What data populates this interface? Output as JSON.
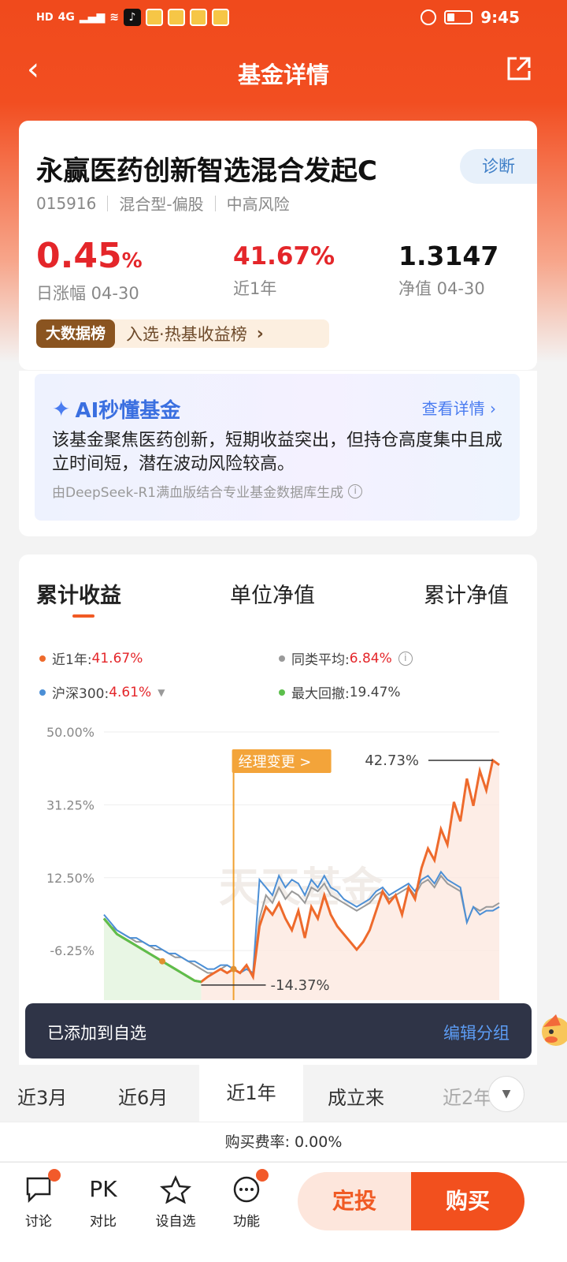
{
  "status_bar": {
    "hd": "HD",
    "network": "4G",
    "time": "9:45"
  },
  "nav": {
    "title": "基金详情"
  },
  "fund": {
    "name": "永赢医药创新智选混合发起C",
    "code": "015916",
    "type": "混合型-偏股",
    "risk": "中高风险",
    "diagnose_label": "诊断",
    "daily_change": "0.45",
    "daily_change_unit": "%",
    "daily_change_label": "日涨幅 04-30",
    "year_return": "41.67%",
    "year_return_label": "近1年",
    "nav_value": "1.3147",
    "nav_label": "净值 04-30",
    "rank_tag": "大数据榜",
    "rank_text": "入选·热基收益榜"
  },
  "ai": {
    "title": "AI秒懂基金",
    "more": "查看详情",
    "body": "该基金聚焦医药创新，短期收益突出，但持仓高度集中且成立时间短，潜在波动风险较高。",
    "footer": "由DeepSeek-R1满血版结合专业基金数据库生成"
  },
  "chart_tabs": [
    "累计收益",
    "单位净值",
    "累计净值"
  ],
  "legend": {
    "fund_label": "近1年:",
    "fund_value": "41.67%",
    "peer_label": "同类平均:",
    "peer_value": "6.84%",
    "index_label": "沪深300:",
    "index_value": "4.61%",
    "drawdown_label": "最大回撤:",
    "drawdown_value": "19.47%"
  },
  "colors": {
    "fund": "#ee6a2c",
    "peer": "#9a9a9a",
    "index": "#4b8fd6",
    "drawdown": "#5cbf4c",
    "accent": "#f2501e"
  },
  "chart_data": {
    "type": "line",
    "ylabel_ticks": [
      "50.00%",
      "31.25%",
      "12.50%",
      "-6.25%"
    ],
    "ylim": [
      -19,
      50
    ],
    "annotations": {
      "manager_change": "经理变更 >",
      "max_label": "42.73%",
      "min_label": "-14.37%",
      "watermark": "天天基金"
    },
    "x_count": 62,
    "series": [
      {
        "key": "fund",
        "values": [
          2,
          0,
          -2,
          -3,
          -4,
          -5,
          -6,
          -7,
          -8,
          -9,
          -10,
          -11,
          -12,
          -13,
          -14,
          -14.3,
          -13,
          -12,
          -11,
          -12,
          -11,
          -12,
          -10,
          -13,
          0,
          5,
          3,
          6,
          2,
          -1,
          4,
          -3,
          5,
          2,
          8,
          3,
          0,
          -2,
          -4,
          -6,
          -4,
          -1,
          4,
          9,
          6,
          8,
          3,
          10,
          7,
          15,
          20,
          17,
          25,
          21,
          32,
          27,
          38,
          31,
          40,
          35,
          42.7,
          41.5
        ]
      },
      {
        "key": "peer",
        "values": [
          2,
          0,
          -1,
          -2,
          -3,
          -4,
          -4,
          -5,
          -6,
          -6,
          -7,
          -8,
          -8,
          -9,
          -10,
          -11,
          -12,
          -12,
          -11,
          -10,
          -11,
          -12,
          -11,
          -12,
          2,
          8,
          6,
          10,
          7,
          9,
          8,
          6,
          10,
          9,
          11,
          8,
          7,
          6,
          5,
          4,
          5,
          6,
          8,
          9,
          7,
          8,
          9,
          10,
          8,
          11,
          12,
          10,
          13,
          11,
          10,
          9,
          1,
          5,
          4,
          5,
          5,
          6
        ]
      },
      {
        "key": "index",
        "values": [
          3,
          1,
          -1,
          -2,
          -3,
          -3,
          -4,
          -5,
          -5,
          -6,
          -7,
          -7,
          -8,
          -9,
          -9,
          -10,
          -11,
          -11,
          -10,
          -10,
          -11,
          -12,
          -11,
          -12,
          12,
          10,
          8,
          13,
          10,
          12,
          11,
          8,
          12,
          10,
          13,
          10,
          9,
          7,
          6,
          5,
          6,
          7,
          9,
          10,
          8,
          9,
          10,
          11,
          9,
          12,
          13,
          11,
          14,
          12,
          11,
          10,
          1,
          5,
          3,
          4,
          4,
          5
        ]
      }
    ]
  },
  "toast": {
    "message": "已添加到自选",
    "action": "编辑分组"
  },
  "periods": [
    "近3月",
    "近6月",
    "近1年",
    "成立来",
    "近2年"
  ],
  "fee": "购买费率: 0.00%",
  "bottom_bar": {
    "discuss": "讨论",
    "pk_icon_text": "PK",
    "pk": "对比",
    "watch": "设自选",
    "func": "功能",
    "dingtou": "定投",
    "buy": "购买"
  }
}
